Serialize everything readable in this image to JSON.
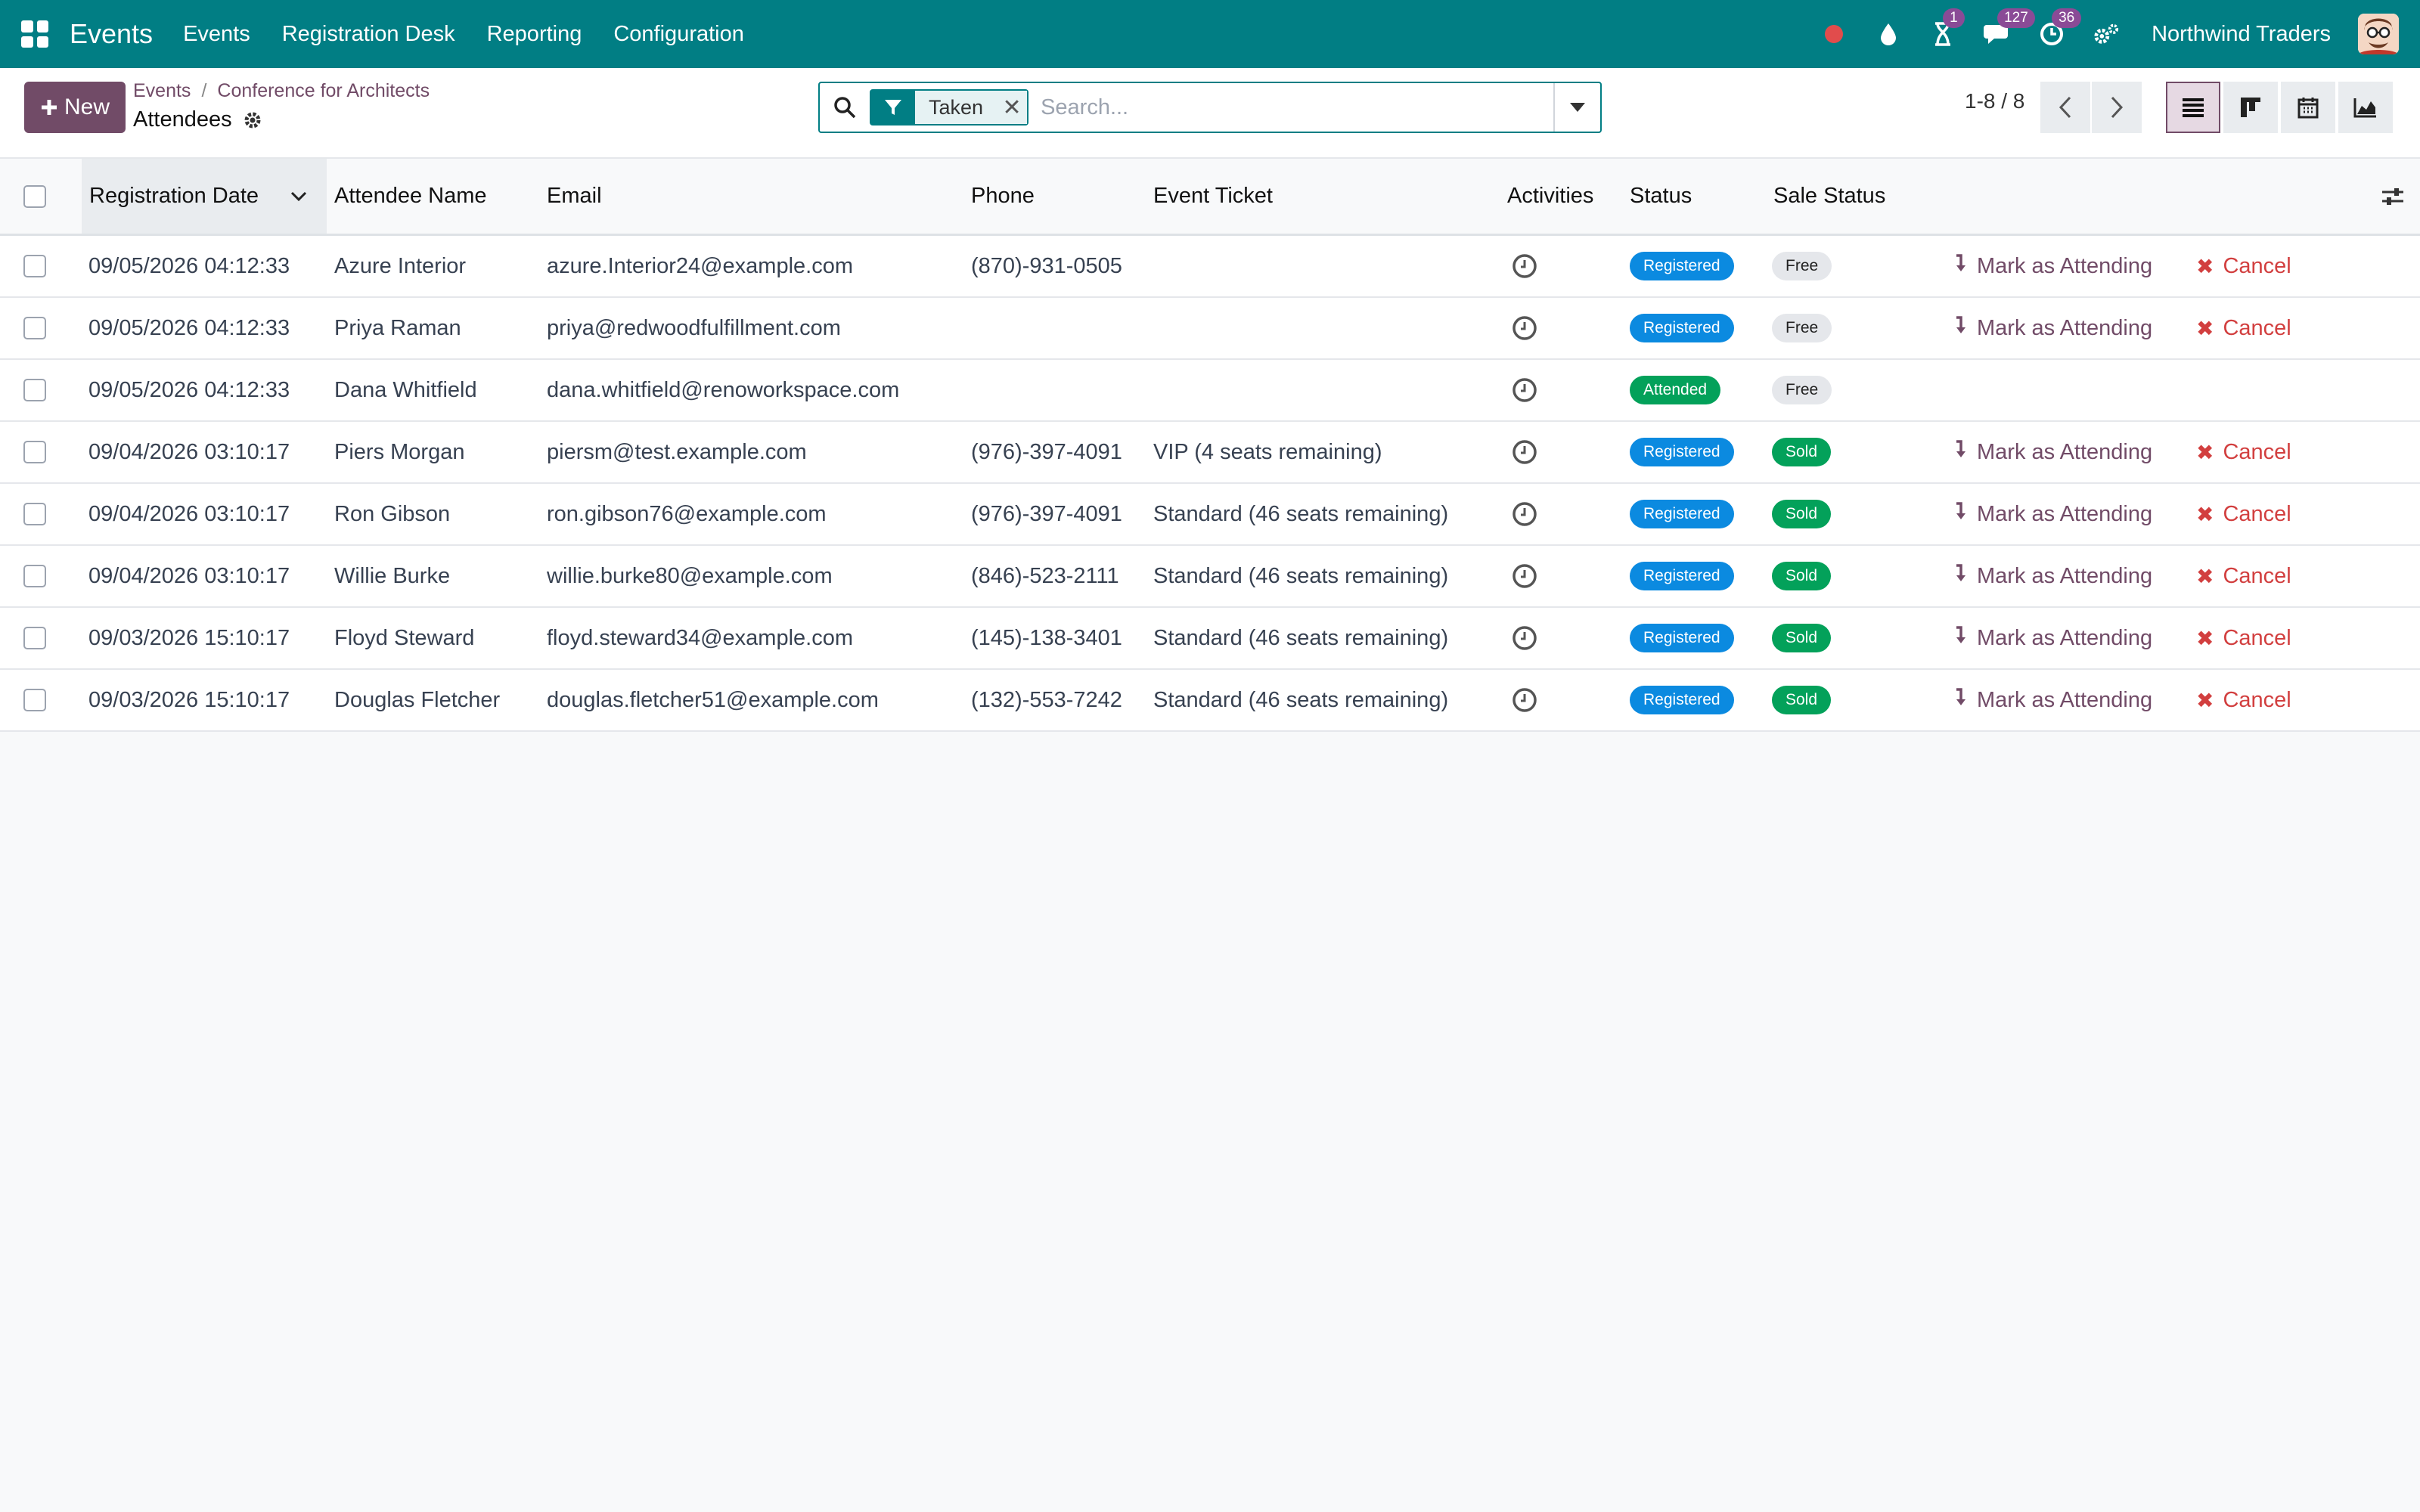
{
  "navbar": {
    "brand": "Events",
    "menu": [
      "Events",
      "Registration Desk",
      "Reporting",
      "Configuration"
    ],
    "badges": {
      "activity": "1",
      "messages": "127",
      "clock": "36"
    },
    "company": "Northwind Traders"
  },
  "control": {
    "new_label": "New",
    "breadcrumb": [
      "Events",
      "Conference for Architects"
    ],
    "title": "Attendees",
    "facet": "Taken",
    "search_placeholder": "Search...",
    "pager": "1-8 / 8"
  },
  "table": {
    "headers": [
      "Registration Date",
      "Attendee Name",
      "Email",
      "Phone",
      "Event Ticket",
      "Activities",
      "Status",
      "Sale Status"
    ],
    "action_attend": "Mark as Attending",
    "action_cancel": "Cancel",
    "rows": [
      {
        "date": "09/05/2026 04:12:33",
        "name": "Azure Interior",
        "email": "azure.Interior24@example.com",
        "phone": "(870)-931-0505",
        "ticket": "",
        "status": "Registered",
        "sale": "Free",
        "actions": true
      },
      {
        "date": "09/05/2026 04:12:33",
        "name": "Priya Raman",
        "email": "priya@redwoodfulfillment.com",
        "phone": "",
        "ticket": "",
        "status": "Registered",
        "sale": "Free",
        "actions": true
      },
      {
        "date": "09/05/2026 04:12:33",
        "name": "Dana Whitfield",
        "email": "dana.whitfield@renoworkspace.com",
        "phone": "",
        "ticket": "",
        "status": "Attended",
        "sale": "Free",
        "actions": false
      },
      {
        "date": "09/04/2026 03:10:17",
        "name": "Piers Morgan",
        "email": "piersm@test.example.com",
        "phone": "(976)-397-4091",
        "ticket": "VIP (4 seats remaining)",
        "status": "Registered",
        "sale": "Sold",
        "actions": true
      },
      {
        "date": "09/04/2026 03:10:17",
        "name": "Ron Gibson",
        "email": "ron.gibson76@example.com",
        "phone": "(976)-397-4091",
        "ticket": "Standard (46 seats remaining)",
        "status": "Registered",
        "sale": "Sold",
        "actions": true
      },
      {
        "date": "09/04/2026 03:10:17",
        "name": "Willie Burke",
        "email": "willie.burke80@example.com",
        "phone": "(846)-523-2111",
        "ticket": "Standard (46 seats remaining)",
        "status": "Registered",
        "sale": "Sold",
        "actions": true
      },
      {
        "date": "09/03/2026 15:10:17",
        "name": "Floyd Steward",
        "email": "floyd.steward34@example.com",
        "phone": "(145)-138-3401",
        "ticket": "Standard (46 seats remaining)",
        "status": "Registered",
        "sale": "Sold",
        "actions": true
      },
      {
        "date": "09/03/2026 15:10:17",
        "name": "Douglas Fletcher",
        "email": "douglas.fletcher51@example.com",
        "phone": "(132)-553-7242",
        "ticket": "Standard (46 seats remaining)",
        "status": "Registered",
        "sale": "Sold",
        "actions": true
      }
    ]
  },
  "colors": {
    "brand": "#017e84",
    "primary": "#714b67",
    "registered": "#0b8ae0",
    "attended": "#03a15a",
    "cancel": "#d23f3f"
  }
}
